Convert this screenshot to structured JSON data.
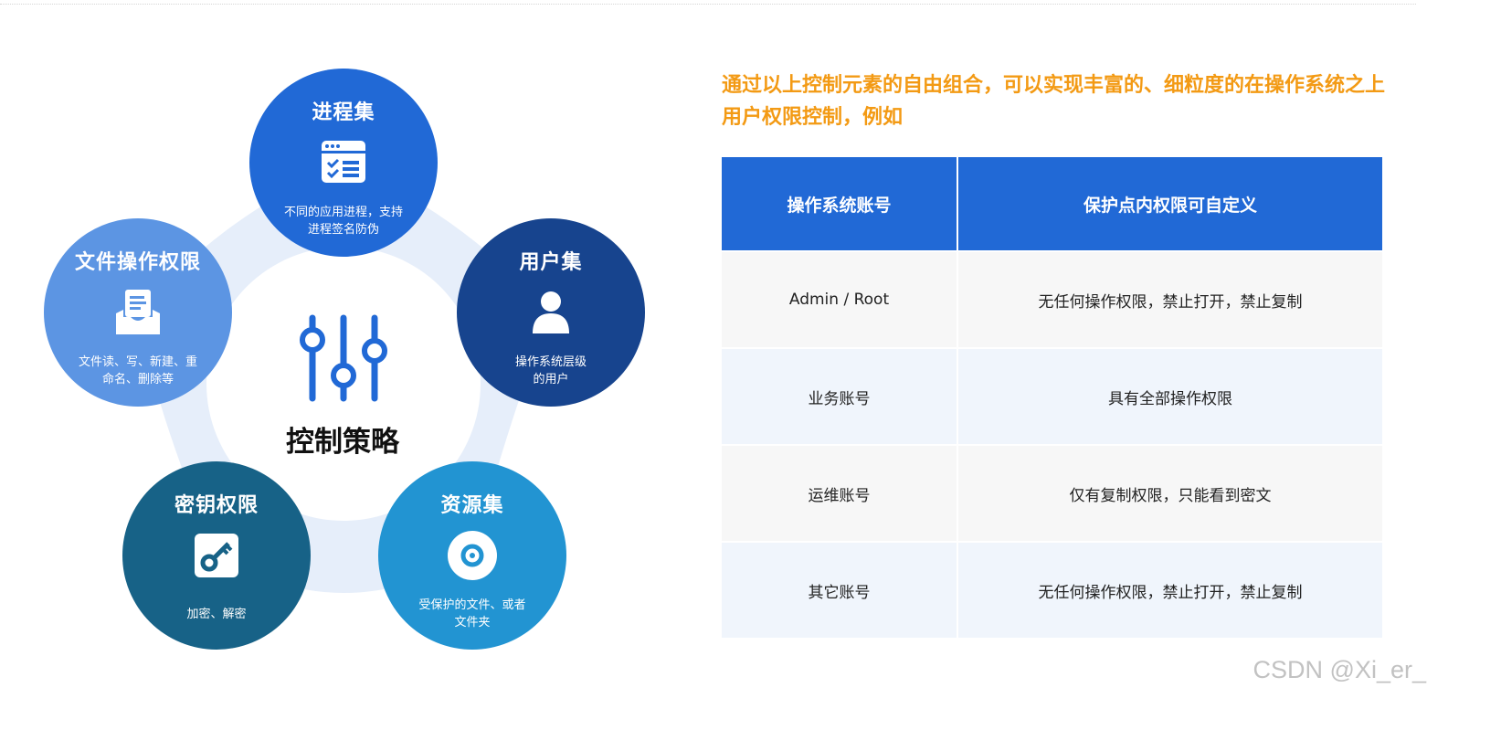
{
  "diagram": {
    "center_label": "控制策略",
    "nodes": [
      {
        "title": "进程集",
        "desc_lines": [
          "不同的应用进程，支持",
          "进程签名防伪"
        ],
        "color": "#2169d6",
        "icon": "process-window-icon"
      },
      {
        "title": "用户集",
        "desc_lines": [
          "操作系统层级",
          "的用户"
        ],
        "color": "#17448e",
        "icon": "user-icon"
      },
      {
        "title": "资源集",
        "desc_lines": [
          "受保护的文件、或者",
          "文件夹"
        ],
        "color": "#2294d2",
        "icon": "target-icon"
      },
      {
        "title": "密钥权限",
        "desc_lines": [
          "加密、解密"
        ],
        "color": "#176287",
        "icon": "key-icon"
      },
      {
        "title": "文件操作权限",
        "desc_lines": [
          "文件读、写、新建、重",
          "命名、删除等"
        ],
        "color": "#5c95e3",
        "icon": "inbox-document-icon"
      }
    ],
    "petal_color": "#e6eefa"
  },
  "headline": "通过以上控制元素的自由组合，可以实现丰富的、细粒度的在操作系统之上用户权限控制，例如",
  "table": {
    "headers": [
      "操作系统账号",
      "保护点内权限可自定义"
    ],
    "rows": [
      [
        "Admin / Root",
        "无任何操作权限，禁止打开，禁止复制"
      ],
      [
        "业务账号",
        "具有全部操作权限"
      ],
      [
        "运维账号",
        "仅有复制权限，只能看到密文"
      ],
      [
        "其它账号",
        "无任何操作权限，禁止打开，禁止复制"
      ]
    ],
    "header_color": "#2169d6"
  },
  "watermark": "CSDN @Xi_er_",
  "colors": {
    "accent_orange": "#f39a14"
  }
}
